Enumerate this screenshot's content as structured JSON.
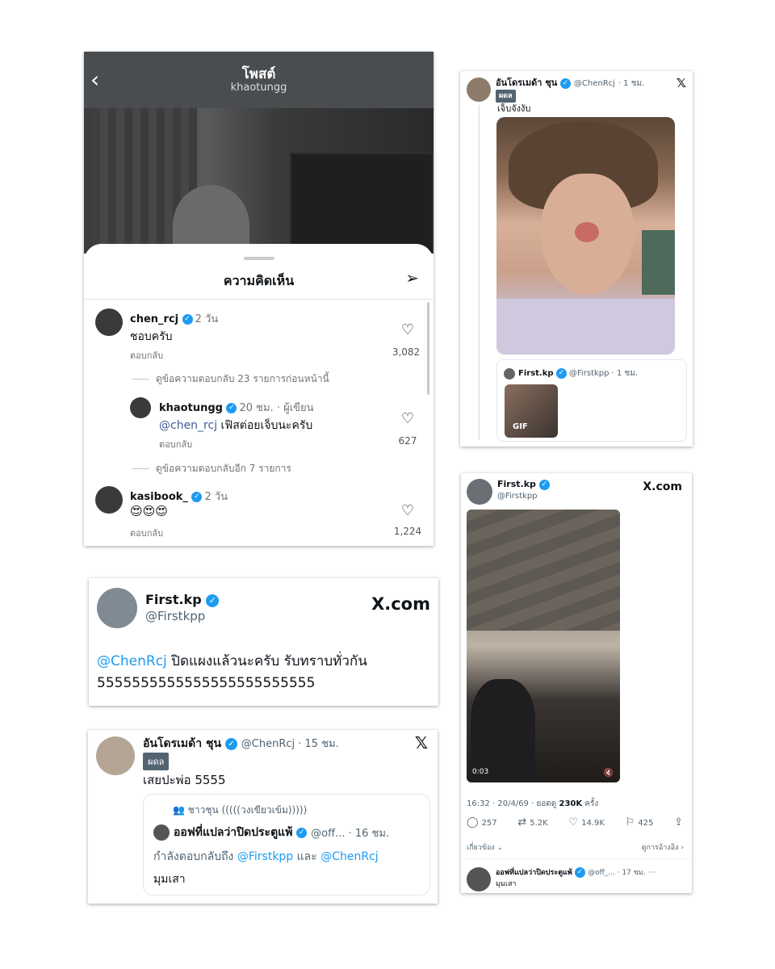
{
  "instagram": {
    "header_title": "โพสต์",
    "header_subtitle": "khaotungg",
    "sheet_title": "ความคิดเห็น",
    "comments": [
      {
        "user": "chen_rcj",
        "time": "2 วัน",
        "text": "ชอบครับ",
        "reply": "ตอบกลับ",
        "likes": "3,082"
      },
      {
        "user": "khaotungg",
        "time": "20 ชม. · ผู้เขียน",
        "mention": "@chen_rcj",
        "text": " เฟิสต่อยเจ็บนะครับ",
        "reply": "ตอบกลับ",
        "likes": "627"
      },
      {
        "user": "kasibook_",
        "time": "2 วัน",
        "text": "😍😍😍",
        "reply": "ตอบกลับ",
        "likes": "1,224"
      }
    ],
    "view_previous": "ดูข้อความตอบกลับ 23 รายการก่อนหน้านี้",
    "view_more": "ดูข้อความตอบกลับอีก 7 รายการ"
  },
  "x_post_1": {
    "name": "อันโดรเมด้า ชุน",
    "handle": "@ChenRcj",
    "time": "· 1 ชม.",
    "tag": "ผดล",
    "text": "เจ็บจังงับ",
    "quote_name": "First.kp",
    "quote_handle": "@Firstkpp",
    "quote_time": "· 1 ชม.",
    "gif_label": "GIF"
  },
  "x_post_2": {
    "name": "First.kp",
    "handle": "@Firstkpp",
    "brand": "X.com",
    "duration": "0:03",
    "meta_prefix": "16:32 · 20/4/69 · ยอดดู ",
    "views": "230K",
    "meta_suffix": " ครั้ง",
    "replies": "257",
    "reposts": "5.2K",
    "likes": "14.9K",
    "bookmarks": "425",
    "related": "เกี่ยวข้อง",
    "quotes": "ดูการอ้างอิง",
    "reply_name": "ออฟที่แปลว่าปิดประตูแพ้",
    "reply_handle": "@off_... · 17 ชม.",
    "reply_text": "มุมเสา"
  },
  "x_post_3": {
    "name": "First.kp",
    "handle": "@Firstkpp",
    "brand": "X.com",
    "mention": "@ChenRcj",
    "text": " ปิดแผงแล้วนะครับ รับทราบทั่วกัน",
    "text2": "5555555555555555555555555"
  },
  "x_post_4": {
    "name": "อันโดรเมด้า ชุน",
    "handle": "@ChenRcj · 15 ชม.",
    "tag": "ผดล",
    "text": "เสยปะพ่อ 5555",
    "community": "ชาวชุน (((((วงเขียวเข้ม)))))",
    "quote_name": "ออฟที่แปลว่าปิดประตูแพ้",
    "quote_handle": "@off... · 16 ชม.",
    "replying_prefix": "กำลังตอบกลับถึง ",
    "replying_user1": "@Firstkpp",
    "replying_and": " และ ",
    "replying_user2": "@ChenRcj",
    "quote_text": "มุมเสา"
  },
  "colors": {
    "x_blue": "#1d9bf0",
    "ig_header": "#4a4d50"
  }
}
